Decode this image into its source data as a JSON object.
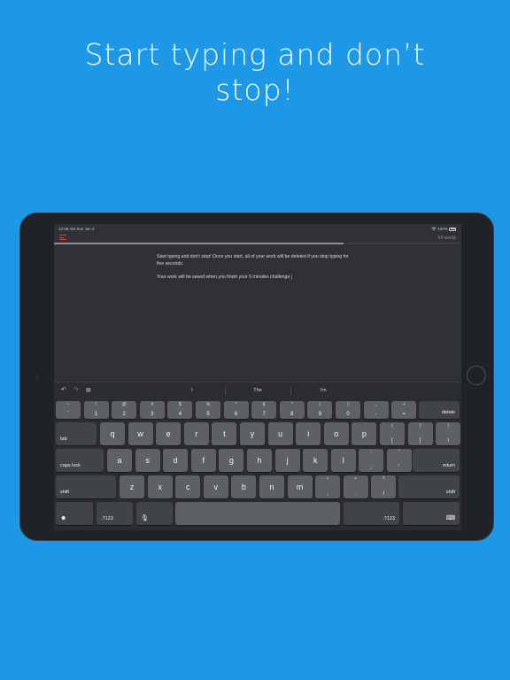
{
  "headline": {
    "line1": "Start typing and don’t",
    "line2": "stop!"
  },
  "status_bar": {
    "time_date": "12:09 AM   Sun Jan 3",
    "battery": "100%",
    "wifi_icon": "wifi-icon",
    "battery_icon": "battery-icon"
  },
  "app": {
    "menu_icon": "hamburger-menu-icon",
    "accent_color": "#e23b3b",
    "word_count": "54 words",
    "progress": 0.71,
    "paragraphs": [
      "Start typing and don't stop! Once you start, all of your work will be deleted if you stop typing for five seconds.",
      "Your work will be saved when you finish your 5 minutes challenge."
    ]
  },
  "keyboard_bar": {
    "undo_icon": "undo-icon",
    "redo_icon": "redo-icon",
    "paste_icon": "paste-icon",
    "suggestions": [
      "I",
      "The",
      "I'm"
    ]
  },
  "keyboard": {
    "row1": [
      {
        "top": "~",
        "bottom": "`"
      },
      {
        "top": "!",
        "bottom": "1"
      },
      {
        "top": "@",
        "bottom": "2"
      },
      {
        "top": "#",
        "bottom": "3"
      },
      {
        "top": "$",
        "bottom": "4"
      },
      {
        "top": "%",
        "bottom": "5"
      },
      {
        "top": "^",
        "bottom": "6"
      },
      {
        "top": "&",
        "bottom": "7"
      },
      {
        "top": "*",
        "bottom": "8"
      },
      {
        "top": "(",
        "bottom": "9"
      },
      {
        "top": ")",
        "bottom": "0"
      },
      {
        "top": "_",
        "bottom": "-"
      },
      {
        "top": "+",
        "bottom": "="
      }
    ],
    "delete": "delete",
    "tab": "tab",
    "row2": [
      "q",
      "w",
      "e",
      "r",
      "t",
      "y",
      "u",
      "i",
      "o",
      "p"
    ],
    "row2_sym": [
      {
        "top": "{",
        "bottom": "["
      },
      {
        "top": "}",
        "bottom": "]"
      },
      {
        "top": "|",
        "bottom": "\\"
      }
    ],
    "caps_lock": "caps lock",
    "row3": [
      "a",
      "s",
      "d",
      "f",
      "g",
      "h",
      "j",
      "k",
      "l"
    ],
    "row3_sym": [
      {
        "top": ":",
        "bottom": ";"
      },
      {
        "top": "\"",
        "bottom": "'"
      }
    ],
    "return": "return",
    "shift": "shift",
    "row4": [
      "z",
      "x",
      "c",
      "v",
      "b",
      "n",
      "m"
    ],
    "row4_sym": [
      {
        "top": "<",
        "bottom": ","
      },
      {
        "top": ">",
        "bottom": "."
      },
      {
        "top": "?",
        "bottom": "/"
      }
    ],
    "emoji_icon": "emoji-icon",
    "numbers": ".?123",
    "mic_icon": "microphone-icon",
    "keyboard_hide_icon": "keyboard-dismiss-icon"
  }
}
